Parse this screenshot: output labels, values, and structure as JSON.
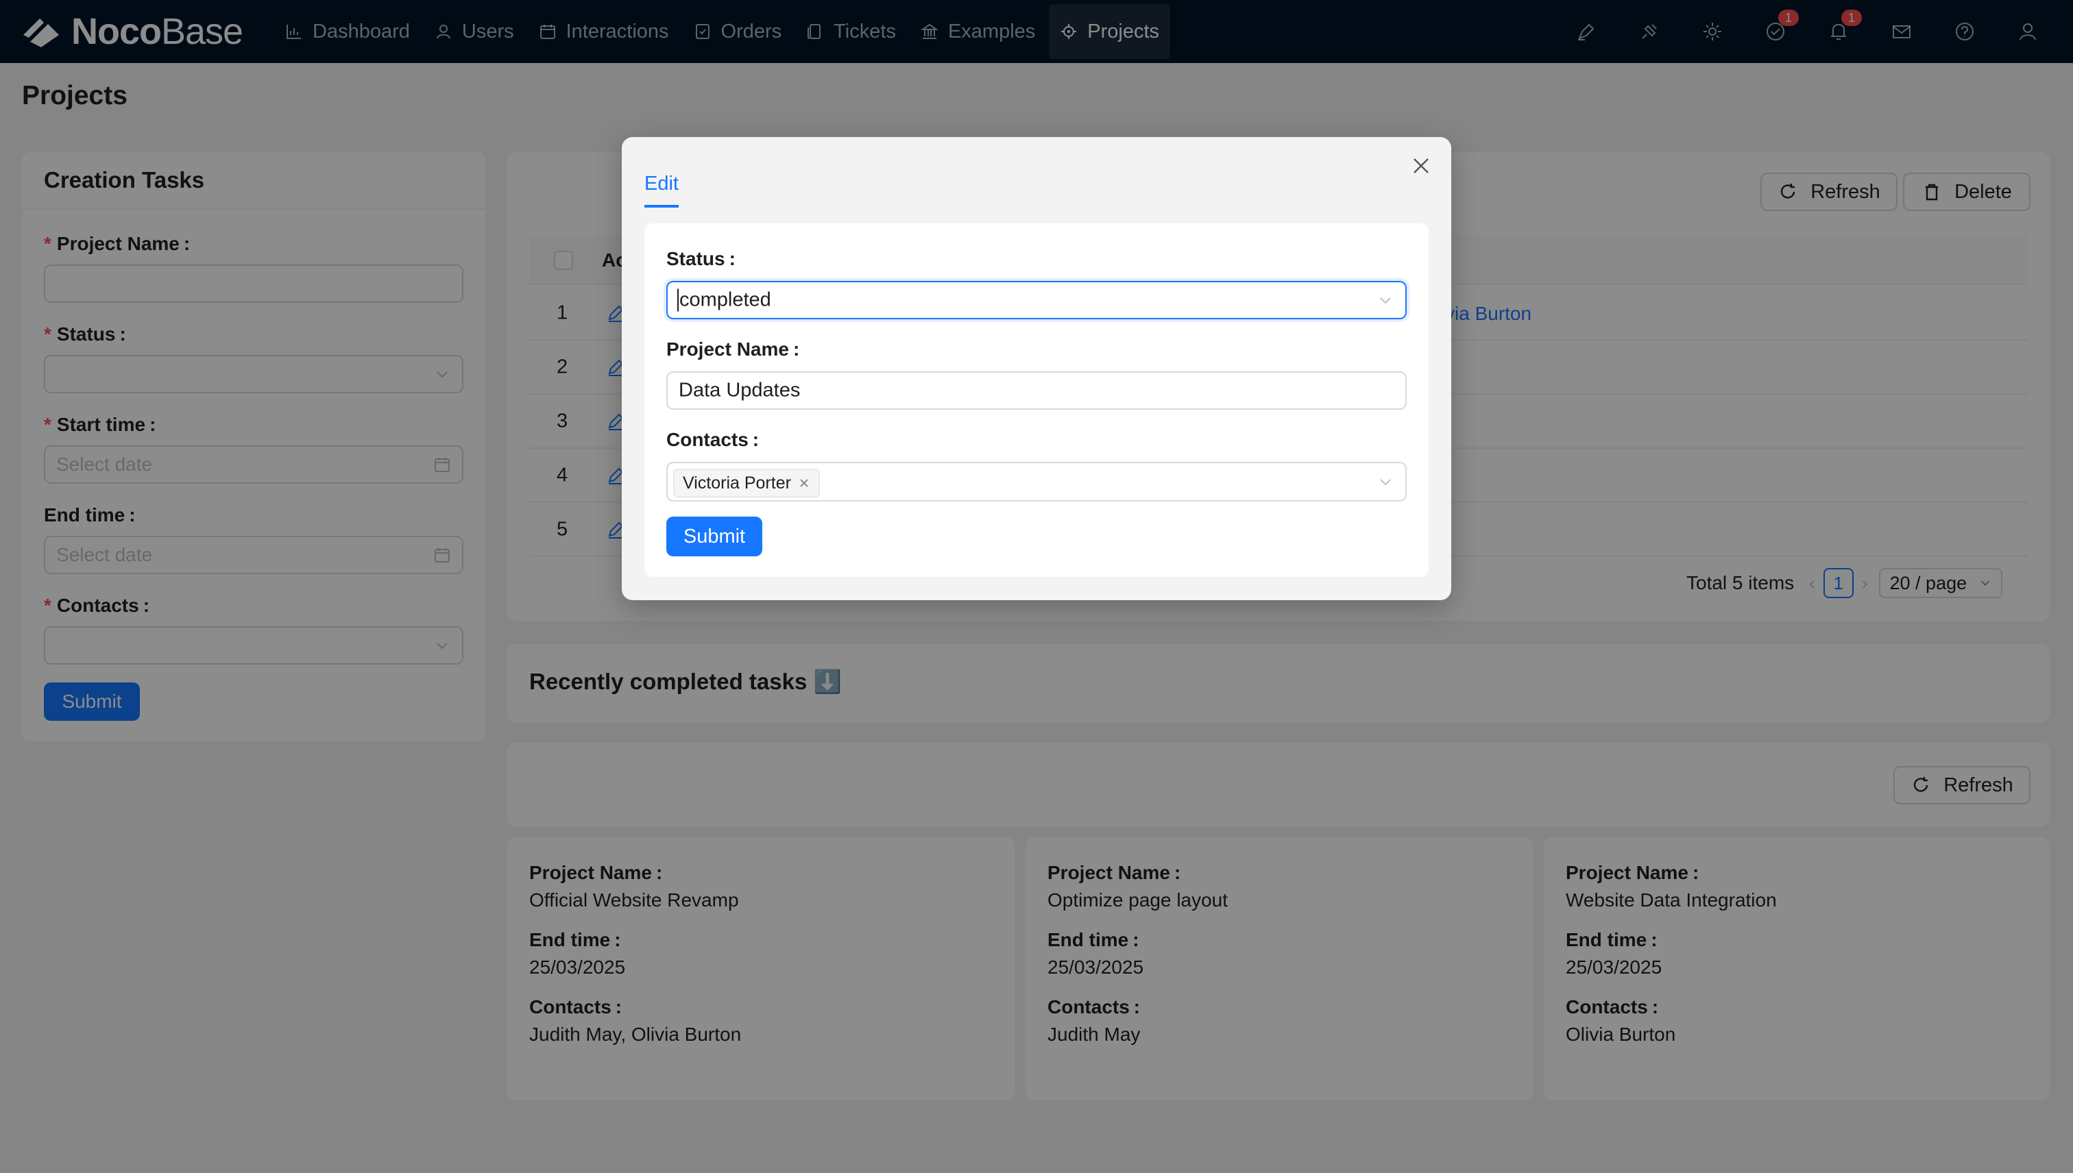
{
  "app": {
    "brand_bold": "Noco",
    "brand_thin": "Base",
    "page_title": "Projects"
  },
  "nav": {
    "items": [
      {
        "label": "Dashboard",
        "icon": "bar-chart-icon"
      },
      {
        "label": "Users",
        "icon": "user-icon"
      },
      {
        "label": "Interactions",
        "icon": "calendar-icon"
      },
      {
        "label": "Orders",
        "icon": "order-icon"
      },
      {
        "label": "Tickets",
        "icon": "ticket-icon"
      },
      {
        "label": "Examples",
        "icon": "bank-icon"
      },
      {
        "label": "Projects",
        "icon": "target-icon",
        "active": true
      }
    ],
    "tools": [
      {
        "icon": "highlight-icon"
      },
      {
        "icon": "plugin-icon"
      },
      {
        "icon": "settings-icon"
      },
      {
        "icon": "check-circle-icon",
        "badge": "1"
      },
      {
        "icon": "bell-icon",
        "badge": "1"
      },
      {
        "icon": "mail-icon"
      },
      {
        "icon": "help-icon"
      },
      {
        "icon": "user-icon"
      }
    ]
  },
  "creation_form": {
    "title": "Creation Tasks",
    "project_name_label": "Project Name",
    "status_label": "Status",
    "start_time_label": "Start time",
    "start_time_placeholder": "Select date",
    "end_time_label": "End time",
    "end_time_placeholder": "Select date",
    "contacts_label": "Contacts",
    "submit_label": "Submit"
  },
  "table": {
    "refresh_label": "Refresh",
    "delete_label": "Delete",
    "header_partial": "Ac",
    "rows": [
      {
        "index": "1",
        "contact_partial": "via Burton"
      },
      {
        "index": "2"
      },
      {
        "index": "3"
      },
      {
        "index": "4"
      },
      {
        "index": "5"
      }
    ],
    "total_text": "Total 5 items",
    "current_page": "1",
    "page_size": "20 / page"
  },
  "recent": {
    "title": "Recently completed tasks ⬇️",
    "refresh_label": "Refresh",
    "cards": [
      {
        "project_name_label": "Project Name",
        "project_name": "Official Website Revamp",
        "end_time_label": "End time",
        "end_time": "25/03/2025",
        "contacts_label": "Contacts",
        "contacts": "Judith May, Olivia Burton"
      },
      {
        "project_name_label": "Project Name",
        "project_name": "Optimize page layout",
        "end_time_label": "End time",
        "end_time": "25/03/2025",
        "contacts_label": "Contacts",
        "contacts": "Judith May"
      },
      {
        "project_name_label": "Project Name",
        "project_name": "Website Data Integration",
        "end_time_label": "End time",
        "end_time": "25/03/2025",
        "contacts_label": "Contacts",
        "contacts": "Olivia Burton"
      }
    ]
  },
  "modal": {
    "tab_label": "Edit",
    "status_label": "Status",
    "status_value": "completed",
    "project_name_label": "Project Name",
    "project_name_value": "Data Updates",
    "contacts_label": "Contacts",
    "contact_tag": "Victoria Porter",
    "submit_label": "Submit"
  },
  "colors": {
    "primary": "#1677ff",
    "header_bg": "#001529",
    "danger": "#ff4d4f"
  }
}
